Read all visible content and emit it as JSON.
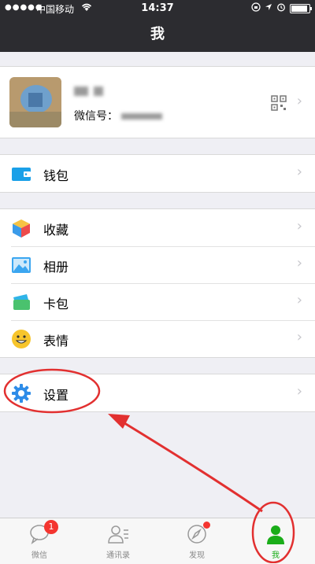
{
  "status_bar": {
    "signal": "●●●●●",
    "carrier": "中国移动",
    "time": "14:37",
    "battery_level": 0.85
  },
  "nav": {
    "title": "我"
  },
  "profile": {
    "name": "",
    "wechat_id_label": "微信号："
  },
  "menu": {
    "wallet": "钱包",
    "favorites": "收藏",
    "album": "相册",
    "cards": "卡包",
    "stickers": "表情",
    "settings": "设置"
  },
  "tabs": [
    {
      "label": "微信",
      "badge": "1"
    },
    {
      "label": "通讯录"
    },
    {
      "label": "发现"
    },
    {
      "label": "我"
    }
  ],
  "colors": {
    "nav_bg": "#2c2c30",
    "page_bg": "#efeff4",
    "accent_green": "#1aad19",
    "badge_red": "#f43530",
    "annotation_red": "#e23030"
  }
}
